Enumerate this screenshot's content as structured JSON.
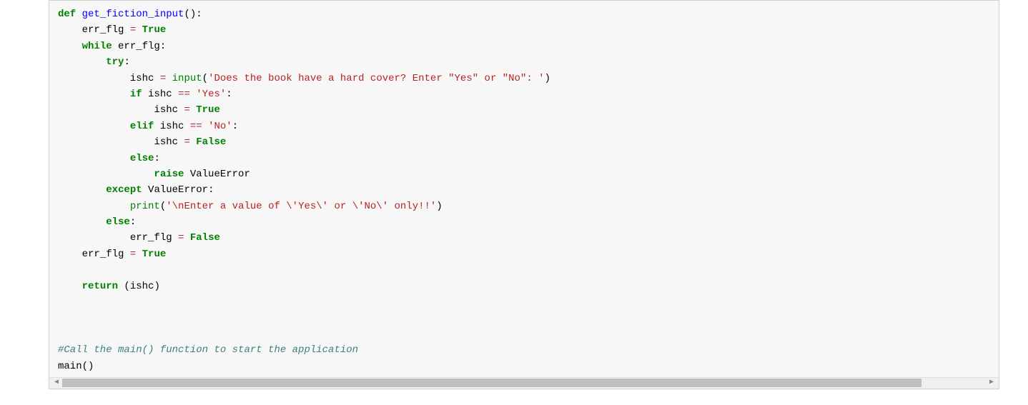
{
  "code": {
    "lines": [
      {
        "indent": 0,
        "tokens": [
          {
            "cls": "kw",
            "text": "def"
          },
          {
            "cls": "plain",
            "text": " "
          },
          {
            "cls": "fn",
            "text": "get_fiction_input"
          },
          {
            "cls": "plain",
            "text": "():"
          }
        ]
      },
      {
        "indent": 1,
        "tokens": [
          {
            "cls": "plain",
            "text": "err_flg "
          },
          {
            "cls": "op",
            "text": "="
          },
          {
            "cls": "plain",
            "text": " "
          },
          {
            "cls": "kw",
            "text": "True"
          }
        ]
      },
      {
        "indent": 1,
        "tokens": [
          {
            "cls": "kw",
            "text": "while"
          },
          {
            "cls": "plain",
            "text": " err_flg:"
          }
        ]
      },
      {
        "indent": 2,
        "tokens": [
          {
            "cls": "kw",
            "text": "try"
          },
          {
            "cls": "plain",
            "text": ":"
          }
        ]
      },
      {
        "indent": 3,
        "tokens": [
          {
            "cls": "plain",
            "text": "ishc "
          },
          {
            "cls": "op",
            "text": "="
          },
          {
            "cls": "plain",
            "text": " "
          },
          {
            "cls": "builtin",
            "text": "input"
          },
          {
            "cls": "plain",
            "text": "("
          },
          {
            "cls": "str",
            "text": "'Does the book have a hard cover? Enter \"Yes\" or \"No\": '"
          },
          {
            "cls": "plain",
            "text": ")"
          }
        ]
      },
      {
        "indent": 3,
        "tokens": [
          {
            "cls": "kw",
            "text": "if"
          },
          {
            "cls": "plain",
            "text": " ishc "
          },
          {
            "cls": "op",
            "text": "=="
          },
          {
            "cls": "plain",
            "text": " "
          },
          {
            "cls": "str",
            "text": "'Yes'"
          },
          {
            "cls": "plain",
            "text": ":"
          }
        ]
      },
      {
        "indent": 4,
        "tokens": [
          {
            "cls": "plain",
            "text": "ishc "
          },
          {
            "cls": "op",
            "text": "="
          },
          {
            "cls": "plain",
            "text": " "
          },
          {
            "cls": "kw",
            "text": "True"
          }
        ]
      },
      {
        "indent": 3,
        "tokens": [
          {
            "cls": "kw",
            "text": "elif"
          },
          {
            "cls": "plain",
            "text": " ishc "
          },
          {
            "cls": "op",
            "text": "=="
          },
          {
            "cls": "plain",
            "text": " "
          },
          {
            "cls": "str",
            "text": "'No'"
          },
          {
            "cls": "plain",
            "text": ":"
          }
        ]
      },
      {
        "indent": 4,
        "tokens": [
          {
            "cls": "plain",
            "text": "ishc "
          },
          {
            "cls": "op",
            "text": "="
          },
          {
            "cls": "plain",
            "text": " "
          },
          {
            "cls": "kw",
            "text": "False"
          }
        ]
      },
      {
        "indent": 3,
        "tokens": [
          {
            "cls": "kw",
            "text": "else"
          },
          {
            "cls": "plain",
            "text": ":"
          }
        ]
      },
      {
        "indent": 4,
        "tokens": [
          {
            "cls": "kw",
            "text": "raise"
          },
          {
            "cls": "plain",
            "text": " "
          },
          {
            "cls": "exc",
            "text": "ValueError"
          }
        ]
      },
      {
        "indent": 2,
        "tokens": [
          {
            "cls": "kw",
            "text": "except"
          },
          {
            "cls": "plain",
            "text": " "
          },
          {
            "cls": "exc",
            "text": "ValueError"
          },
          {
            "cls": "plain",
            "text": ":"
          }
        ]
      },
      {
        "indent": 3,
        "tokens": [
          {
            "cls": "builtin",
            "text": "print"
          },
          {
            "cls": "plain",
            "text": "("
          },
          {
            "cls": "str",
            "text": "'\\nEnter a value of \\'Yes\\' or \\'No\\' only!!'"
          },
          {
            "cls": "plain",
            "text": ")"
          }
        ]
      },
      {
        "indent": 2,
        "tokens": [
          {
            "cls": "kw",
            "text": "else"
          },
          {
            "cls": "plain",
            "text": ":"
          }
        ]
      },
      {
        "indent": 3,
        "tokens": [
          {
            "cls": "plain",
            "text": "err_flg "
          },
          {
            "cls": "op",
            "text": "="
          },
          {
            "cls": "plain",
            "text": " "
          },
          {
            "cls": "kw",
            "text": "False"
          }
        ]
      },
      {
        "indent": 1,
        "tokens": [
          {
            "cls": "plain",
            "text": "err_flg "
          },
          {
            "cls": "op",
            "text": "="
          },
          {
            "cls": "plain",
            "text": " "
          },
          {
            "cls": "kw",
            "text": "True"
          }
        ]
      },
      {
        "indent": 0,
        "tokens": []
      },
      {
        "indent": 1,
        "tokens": [
          {
            "cls": "kw",
            "text": "return"
          },
          {
            "cls": "plain",
            "text": " (ishc)"
          }
        ]
      },
      {
        "indent": 0,
        "tokens": []
      },
      {
        "indent": 0,
        "tokens": []
      },
      {
        "indent": 0,
        "tokens": []
      },
      {
        "indent": 0,
        "tokens": [
          {
            "cls": "cmt",
            "text": "#Call the main() function to start the application"
          }
        ]
      },
      {
        "indent": 0,
        "tokens": [
          {
            "cls": "plain",
            "text": "main()"
          }
        ]
      }
    ],
    "indent_unit": "    "
  },
  "scrollbar": {
    "left_arrow": "◀",
    "right_arrow": "▶"
  }
}
